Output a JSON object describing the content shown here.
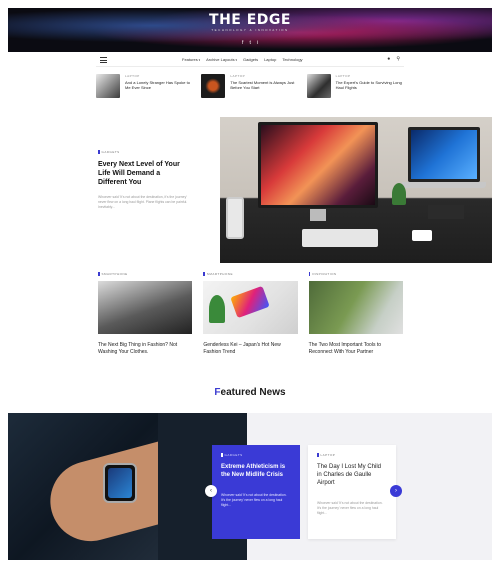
{
  "header": {
    "brand": "THE EDGE",
    "tagline": "TECHNOLOGY & INNOVATION",
    "socials": [
      "f",
      "t",
      "i"
    ]
  },
  "nav": {
    "menu": [
      "Features",
      "Archive Layouts",
      "Gadgets",
      "Laptop",
      "Technology"
    ],
    "icons": [
      "menu-icon",
      "user-icon",
      "search-icon"
    ]
  },
  "strip": [
    {
      "category": "LAPTOP",
      "title": "And a Lonely Stranger Has Spoke to Me Ever Since"
    },
    {
      "category": "LAPTOP",
      "title": "The Scariest Moment is Always Just Before You Start"
    },
    {
      "category": "LAPTOP",
      "title": "The Expert's Guide to Surviving Long Haul Flights"
    }
  ],
  "feature": {
    "category": "GADGETS",
    "title": "Every Next Level of Your Life Will Demand a Different You",
    "description": "Whoever said 'It's not about the destination, it's the journey' never flew on a long haul flight. Plane flights can be painful. Inevitably..."
  },
  "cards": [
    {
      "category": "SMARTPHONE",
      "title": "The Next Big Thing in Fashion? Not Washing Your Clothes."
    },
    {
      "category": "SMARTPHONE",
      "title": "Genderless Kei – Japan's Hot New Fashion Trend"
    },
    {
      "category": "INSPIRATION",
      "title": "The Two Most Important Tools to Reconnect With Your Partner"
    }
  ],
  "featured_news": {
    "heading_first": "F",
    "heading_rest": "eatured News",
    "slides": [
      {
        "category": "GADGETS",
        "title": "Extreme Athleticism is the New Midlife Crisis",
        "description": "Whoever said 'It's not about the destination. It's the journey' never flew on a long haul flight..."
      },
      {
        "category": "LAPTOP",
        "title": "The Day I Lost My Child in Charles de Gaulle Airport",
        "description": "Whoever said 'It's not about the destination. It's the journey' never flew on a long haul flight..."
      }
    ],
    "prev": "‹",
    "next": "›"
  },
  "colors": {
    "accent": "#3a3ad6"
  }
}
